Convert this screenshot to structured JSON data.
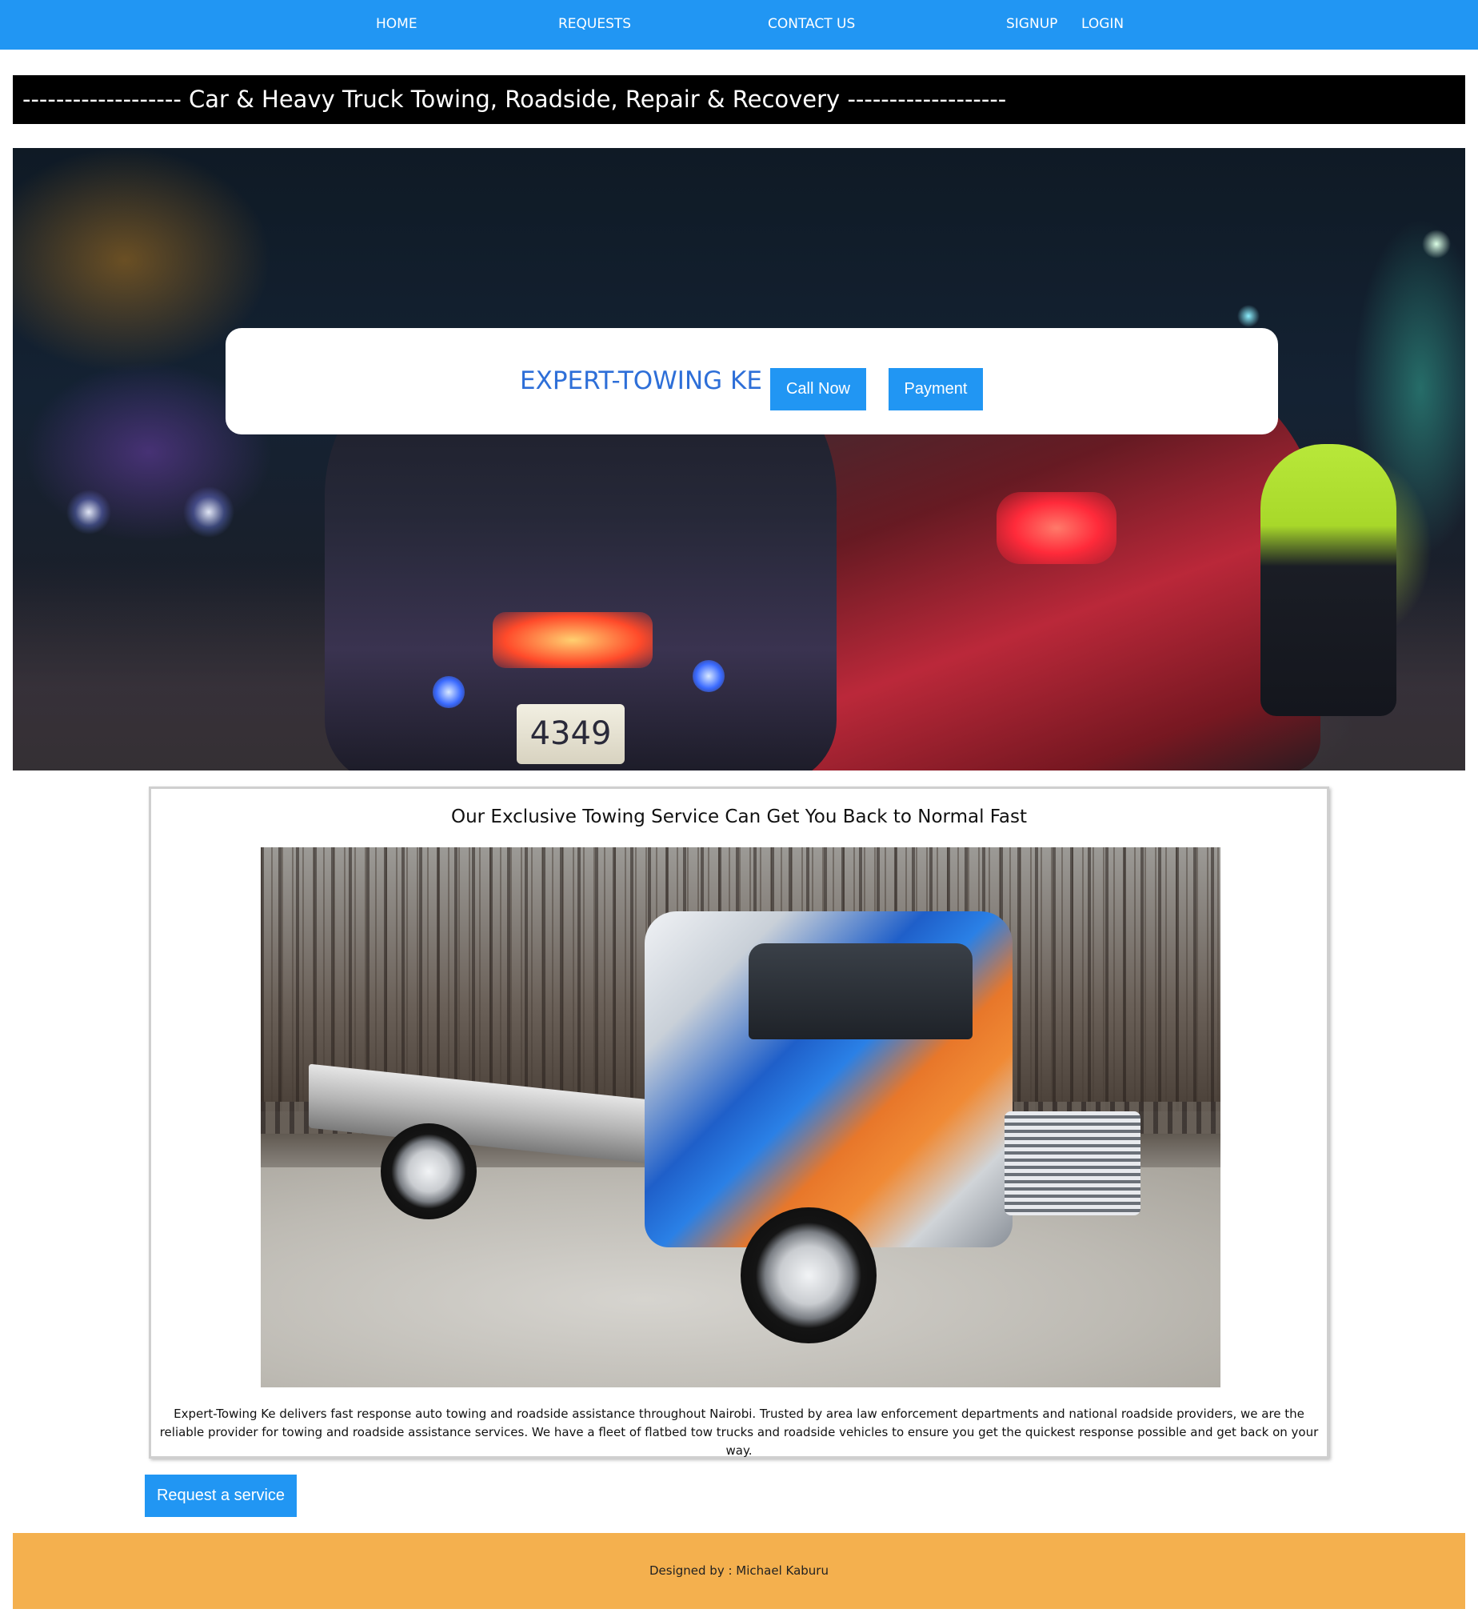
{
  "nav": {
    "home": "HOME",
    "requests": "REQUESTS",
    "contact": "CONTACT US",
    "signup": "SIGNUP",
    "login": "LOGIN"
  },
  "tagline": "------------------- Car & Heavy Truck Towing, Roadside, Repair & Recovery -------------------",
  "hero": {
    "plate_text": "4349",
    "brand": "EXPERT-TOWING KE",
    "call_label": "Call Now",
    "payment_label": "Payment"
  },
  "content": {
    "title": "Our Exclusive Towing Service Can Get You Back to Normal Fast",
    "description": "Expert-Towing Ke delivers fast response auto towing and roadside assistance throughout Nairobi. Trusted by area law enforcement departments and national roadside providers, we are the reliable provider for towing and roadside assistance services. We have a fleet of flatbed tow trucks and roadside vehicles to ensure you get the quickest response possible and get back on your way."
  },
  "request_label": "Request a service",
  "footer": {
    "credit": "Designed by : Michael Kaburu"
  },
  "colors": {
    "nav_bg": "#2196f3",
    "button_bg": "#2196f3",
    "brand_text": "#2e6fd8",
    "footer_bg": "#f4b04e",
    "tagline_bg": "#000000"
  }
}
